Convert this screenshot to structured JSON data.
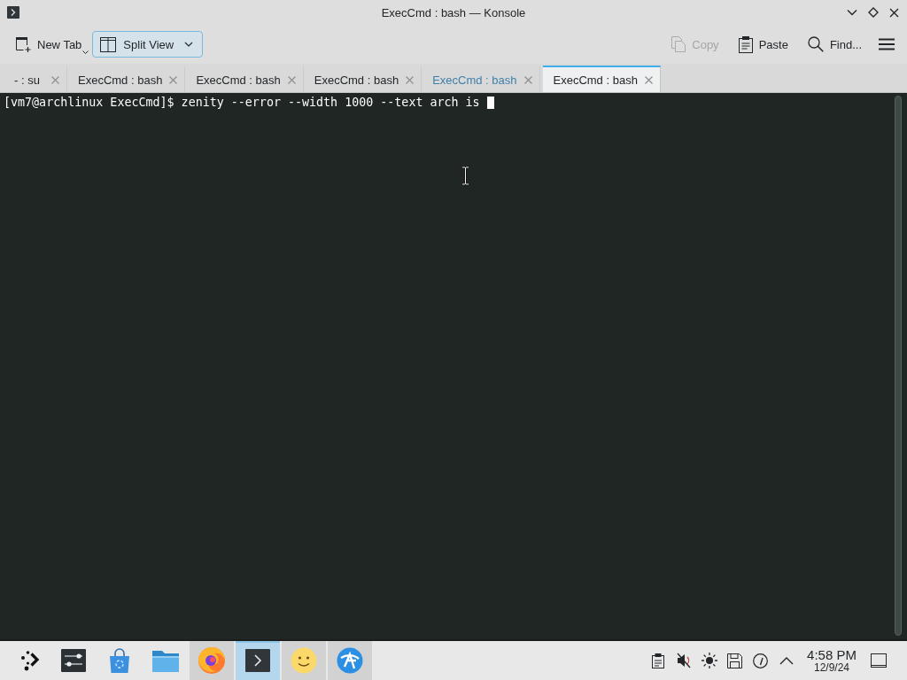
{
  "window": {
    "title": "ExecCmd : bash — Konsole"
  },
  "toolbar": {
    "left_buttons": [
      {
        "label": "New Tab",
        "kind": "dropdown",
        "hovered": false
      },
      {
        "label": "Split View",
        "kind": "split",
        "hovered": true
      }
    ],
    "right_buttons": [
      {
        "label": "Copy",
        "disabled": true
      },
      {
        "label": "Paste",
        "disabled": false
      },
      {
        "label": "Find...",
        "disabled": false
      }
    ]
  },
  "tabs": [
    {
      "label": "- : su",
      "selected": false,
      "activity": false
    },
    {
      "label": "ExecCmd : bash",
      "selected": false,
      "activity": false
    },
    {
      "label": "ExecCmd : bash",
      "selected": false,
      "activity": false
    },
    {
      "label": "ExecCmd : bash",
      "selected": false,
      "activity": false
    },
    {
      "label": "ExecCmd : bash",
      "selected": false,
      "activity": true
    },
    {
      "label": "ExecCmd : bash",
      "selected": true,
      "activity": false
    }
  ],
  "terminal": {
    "lines": [
      "[vm7@archlinux ExecCmd]$ zenity --error --width 1000 --text arch is"
    ]
  },
  "taskbar": {
    "tasks": [
      {
        "running": false,
        "active": false
      },
      {
        "running": false,
        "active": false
      },
      {
        "running": false,
        "active": false
      },
      {
        "running": true,
        "active": false
      },
      {
        "running": true,
        "active": true
      },
      {
        "running": true,
        "active": false
      },
      {
        "running": true,
        "active": false
      }
    ],
    "clock": {
      "time": "4:58 PM",
      "date": "12/9/24"
    }
  }
}
